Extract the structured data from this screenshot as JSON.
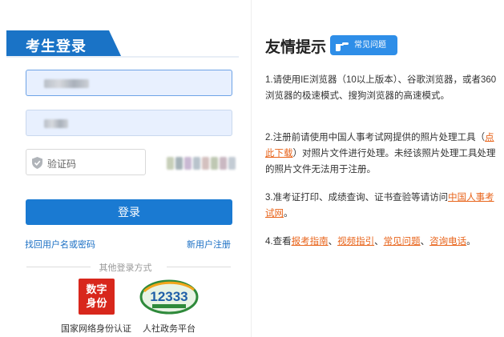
{
  "login": {
    "title": "考生登录",
    "captcha_placeholder": "验证码",
    "login_button": "登录",
    "forgot_link": "找回用户名或密码",
    "register_link": "新用户注册",
    "other_methods": "其他登录方式",
    "alt_login": [
      {
        "badge": "数字身份",
        "label": "国家网络身份认证",
        "color": "#d8271c"
      },
      {
        "badge": "12333",
        "label": "人社政务平台",
        "color": "#2f8a3b"
      }
    ]
  },
  "tips": {
    "title": "友情提示",
    "faq_tag": "常见问题",
    "item1": "1.请使用IE浏览器（10以上版本）、谷歌浏览器，或者360浏览器的极速模式、搜狗浏览器的高速模式。",
    "item2_before": "2.注册前请使用中国人事考试网提供的照片处理工具（",
    "item2_link": "点此下载",
    "item2_after": "）对照片文件进行处理。未经该照片处理工具处理的照片文件无法用于注册。",
    "item3_before": "3.准考证打印、成绩查询、证书查验等请访问",
    "item3_link": "中国人事考试网",
    "item3_after": "。",
    "item4_before": "4.查看",
    "item4_link1": "报考指南",
    "sep": "、",
    "item4_link2": "视频指引",
    "item4_link3": "常见问题",
    "item4_link4": "咨询电话",
    "item4_after": "。"
  },
  "colors": {
    "primary": "#1a7ad2",
    "link": "#1a6fc4",
    "highlight": "#e8641b"
  }
}
